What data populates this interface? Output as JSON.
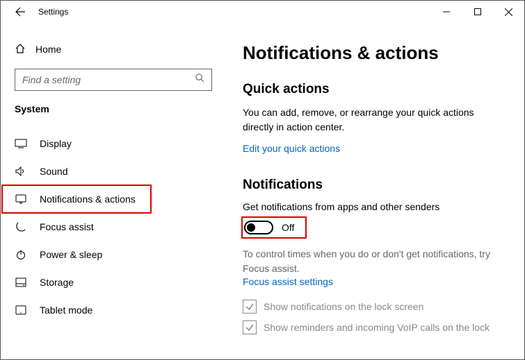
{
  "titlebar": {
    "title": "Settings"
  },
  "sidebar": {
    "home": "Home",
    "search_placeholder": "Find a setting",
    "category": "System",
    "items": [
      {
        "label": "Display"
      },
      {
        "label": "Sound"
      },
      {
        "label": "Notifications & actions"
      },
      {
        "label": "Focus assist"
      },
      {
        "label": "Power & sleep"
      },
      {
        "label": "Storage"
      },
      {
        "label": "Tablet mode"
      }
    ]
  },
  "main": {
    "heading": "Notifications & actions",
    "quick_title": "Quick actions",
    "quick_desc": "You can add, remove, or rearrange your quick actions directly in action center.",
    "quick_link": "Edit your quick actions",
    "notif_title": "Notifications",
    "notif_label": "Get notifications from apps and other senders",
    "toggle_state": "Off",
    "hint": "To control times when you do or don't get notifications, try Focus assist.",
    "hint_link": "Focus assist settings",
    "chk1": "Show notifications on the lock screen",
    "chk2": "Show reminders and incoming VoIP calls on the lock"
  }
}
